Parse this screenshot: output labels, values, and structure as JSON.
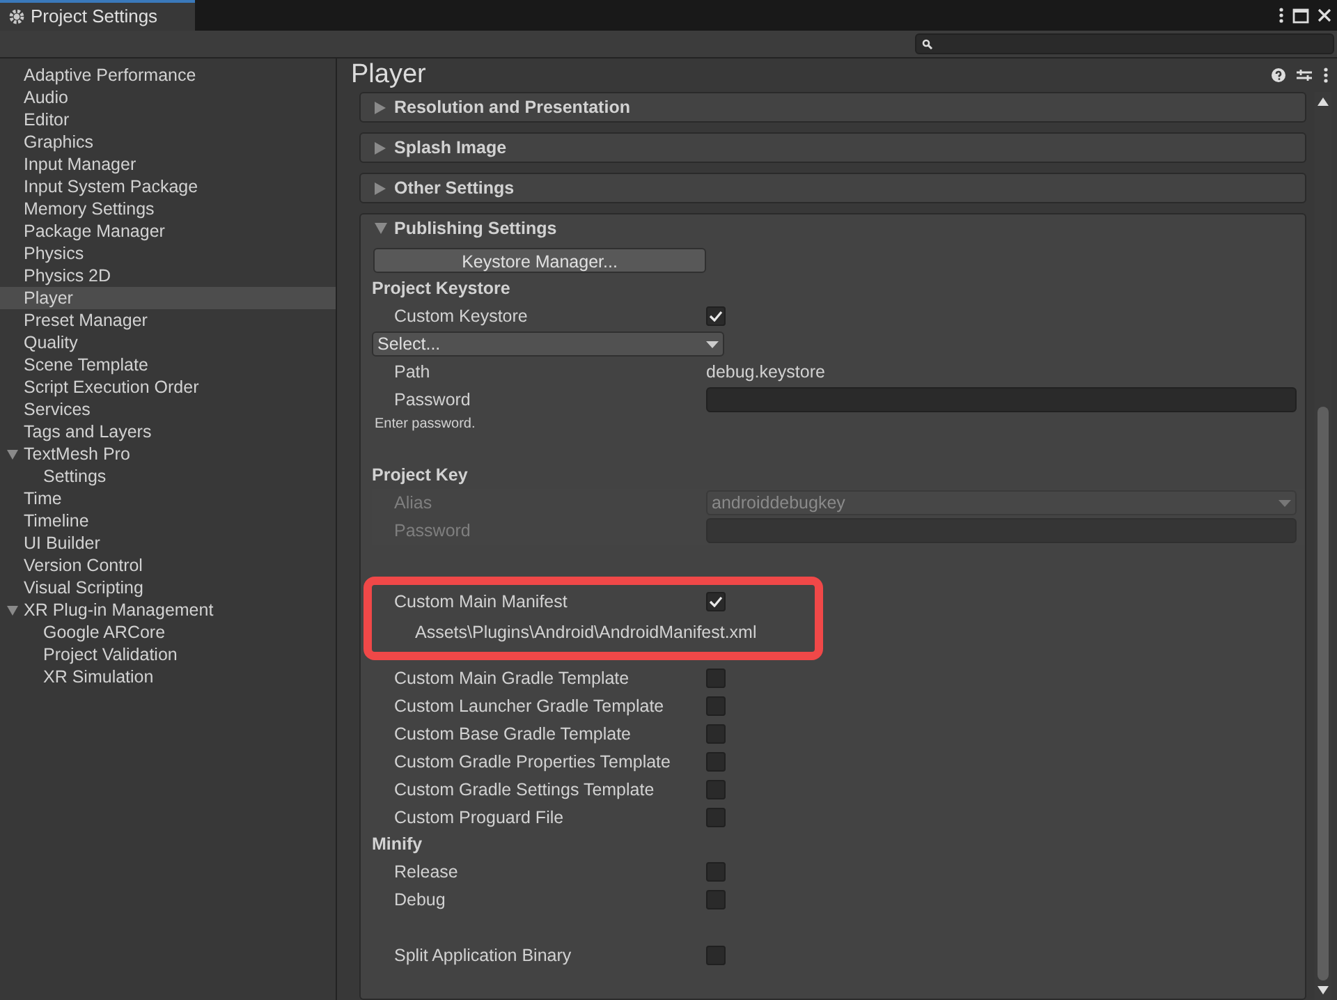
{
  "window": {
    "tab_title": "Project Settings"
  },
  "sidebar": {
    "items": [
      {
        "label": "Adaptive Performance",
        "selected": false
      },
      {
        "label": "Audio",
        "selected": false
      },
      {
        "label": "Editor",
        "selected": false
      },
      {
        "label": "Graphics",
        "selected": false
      },
      {
        "label": "Input Manager",
        "selected": false
      },
      {
        "label": "Input System Package",
        "selected": false
      },
      {
        "label": "Memory Settings",
        "selected": false
      },
      {
        "label": "Package Manager",
        "selected": false
      },
      {
        "label": "Physics",
        "selected": false
      },
      {
        "label": "Physics 2D",
        "selected": false
      },
      {
        "label": "Player",
        "selected": true
      },
      {
        "label": "Preset Manager",
        "selected": false
      },
      {
        "label": "Quality",
        "selected": false
      },
      {
        "label": "Scene Template",
        "selected": false
      },
      {
        "label": "Script Execution Order",
        "selected": false
      },
      {
        "label": "Services",
        "selected": false
      },
      {
        "label": "Tags and Layers",
        "selected": false
      },
      {
        "label": "TextMesh Pro",
        "selected": false,
        "expanded": true,
        "children": [
          {
            "label": "Settings",
            "selected": false
          }
        ]
      },
      {
        "label": "Time",
        "selected": false
      },
      {
        "label": "Timeline",
        "selected": false
      },
      {
        "label": "UI Builder",
        "selected": false
      },
      {
        "label": "Version Control",
        "selected": false
      },
      {
        "label": "Visual Scripting",
        "selected": false
      },
      {
        "label": "XR Plug-in Management",
        "selected": false,
        "expanded": true,
        "children": [
          {
            "label": "Google ARCore",
            "selected": false
          },
          {
            "label": "Project Validation",
            "selected": false
          },
          {
            "label": "XR Simulation",
            "selected": false
          }
        ]
      }
    ]
  },
  "inspector": {
    "title": "Player",
    "sections": [
      {
        "title": "Resolution and Presentation",
        "expanded": false
      },
      {
        "title": "Splash Image",
        "expanded": false
      },
      {
        "title": "Other Settings",
        "expanded": false
      },
      {
        "title": "Publishing Settings",
        "expanded": true,
        "rows": [
          {
            "kind": "button",
            "label": "Keystore Manager..."
          },
          {
            "kind": "heading",
            "label": "Project Keystore"
          },
          {
            "kind": "toggle",
            "label": "Custom Keystore",
            "checked": true
          },
          {
            "kind": "select",
            "value": "Select..."
          },
          {
            "kind": "value",
            "label": "Path",
            "value": "debug.keystore"
          },
          {
            "kind": "field",
            "label": "Password",
            "disabled": false
          },
          {
            "kind": "hint",
            "label": "Enter password."
          },
          {
            "kind": "spacer"
          },
          {
            "kind": "heading",
            "label": "Project Key"
          },
          {
            "kind": "select-field",
            "label": "Alias",
            "value": "androiddebugkey",
            "disabled": true
          },
          {
            "kind": "field",
            "label": "Password",
            "disabled": true
          },
          {
            "kind": "spacer"
          },
          {
            "kind": "highlight",
            "rows": [
              {
                "kind": "toggle",
                "label": "Custom Main Manifest",
                "checked": true
              },
              {
                "kind": "path",
                "label": "Assets\\Plugins\\Android\\AndroidManifest.xml"
              }
            ]
          },
          {
            "kind": "toggle",
            "label": "Custom Main Gradle Template",
            "checked": false
          },
          {
            "kind": "toggle",
            "label": "Custom Launcher Gradle Template",
            "checked": false
          },
          {
            "kind": "toggle",
            "label": "Custom Base Gradle Template",
            "checked": false
          },
          {
            "kind": "toggle",
            "label": "Custom Gradle Properties Template",
            "checked": false
          },
          {
            "kind": "toggle",
            "label": "Custom Gradle Settings Template",
            "checked": false
          },
          {
            "kind": "toggle",
            "label": "Custom Proguard File",
            "checked": false
          },
          {
            "kind": "heading",
            "label": "Minify"
          },
          {
            "kind": "toggle",
            "label": "Release",
            "checked": false
          },
          {
            "kind": "toggle",
            "label": "Debug",
            "checked": false
          },
          {
            "kind": "spacer"
          },
          {
            "kind": "toggle",
            "label": "Split Application Binary",
            "checked": false
          }
        ]
      }
    ]
  }
}
